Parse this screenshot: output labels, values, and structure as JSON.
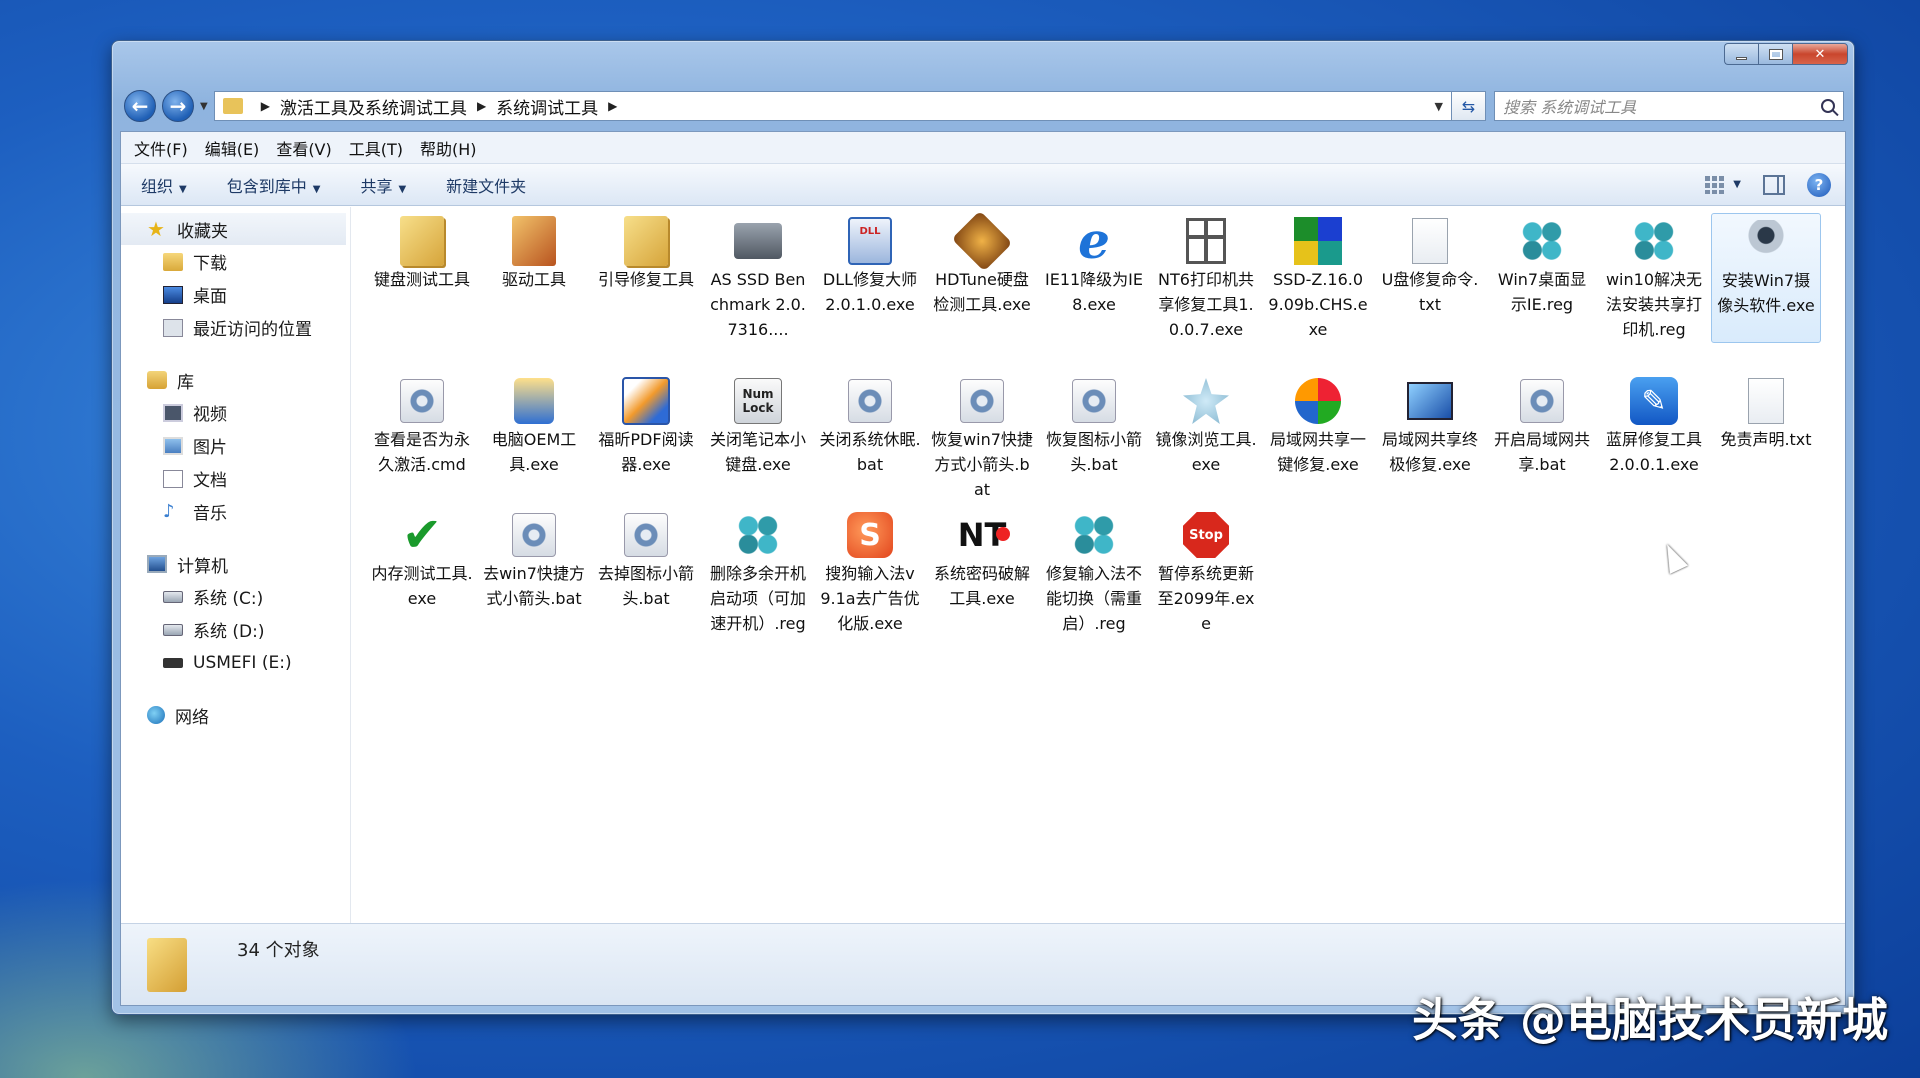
{
  "window": {
    "controls": {
      "minimize": "—",
      "maximize": "□",
      "close": "✕"
    }
  },
  "address": {
    "crumbs": [
      "激活工具及系统调试工具",
      "系统调试工具"
    ],
    "search_placeholder": "搜索 系统调试工具"
  },
  "menu": [
    "文件(F)",
    "编辑(E)",
    "查看(V)",
    "工具(T)",
    "帮助(H)"
  ],
  "toolbar": {
    "organize": "组织",
    "include_library": "包含到库中",
    "share": "共享",
    "new_folder": "新建文件夹"
  },
  "sidebar": {
    "favorites": {
      "label": "收藏夹",
      "items": [
        "下载",
        "桌面",
        "最近访问的位置"
      ]
    },
    "libraries": {
      "label": "库",
      "items": [
        "视频",
        "图片",
        "文档",
        "音乐"
      ]
    },
    "computer": {
      "label": "计算机",
      "items": [
        "系统 (C:)",
        "系统 (D:)",
        "USMEFI (E:)"
      ]
    },
    "network": {
      "label": "网络"
    }
  },
  "files": [
    {
      "name": "键盘测试工具",
      "icon": "folder-icon"
    },
    {
      "name": "驱动工具",
      "icon": "folder-icon"
    },
    {
      "name": "引导修复工具",
      "icon": "folder-icon"
    },
    {
      "name": "AS SSD Benchmark 2.0.7316....",
      "icon": "disk-icon"
    },
    {
      "name": "DLL修复大师2.0.1.0.exe",
      "icon": "dll-icon"
    },
    {
      "name": "HDTune硬盘检测工具.exe",
      "icon": "hdd-icon"
    },
    {
      "name": "IE11降级为IE8.exe",
      "icon": "ie-icon"
    },
    {
      "name": "NT6打印机共享修复工具1.0.0.7.exe",
      "icon": "gift-icon"
    },
    {
      "name": "SSD-Z.16.09.09b.CHS.exe",
      "icon": "ssdz-icon"
    },
    {
      "name": "U盘修复命令.txt",
      "icon": "text-file-icon"
    },
    {
      "name": "Win7桌面显示IE.reg",
      "icon": "registry-icon"
    },
    {
      "name": "win10解决无法安装共享打印机.reg",
      "icon": "registry-icon"
    },
    {
      "name": "安装Win7摄像头软件.exe",
      "icon": "webcam-icon"
    },
    {
      "name": "查看是否为永久激活.cmd",
      "icon": "gear-file-icon"
    },
    {
      "name": "电脑OEM工具.exe",
      "icon": "oem-icon"
    },
    {
      "name": "福昕PDF阅读器.exe",
      "icon": "pdf-icon"
    },
    {
      "name": "关闭笔记本小键盘.exe",
      "icon": "numlock-icon"
    },
    {
      "name": "关闭系统休眠.bat",
      "icon": "gear-file-icon"
    },
    {
      "name": "恢复win7快捷方式小箭头.bat",
      "icon": "gear-file-icon"
    },
    {
      "name": "恢复图标小箭头.bat",
      "icon": "gear-file-icon"
    },
    {
      "name": "镜像浏览工具.exe",
      "icon": "mirror-icon"
    },
    {
      "name": "局域网共享一键修复.exe",
      "icon": "pinwheel-icon"
    },
    {
      "name": "局域网共享终极修复.exe",
      "icon": "monitor-icon"
    },
    {
      "name": "开启局域网共享.bat",
      "icon": "gear-file-icon"
    },
    {
      "name": "蓝屏修复工具2.0.0.1.exe",
      "icon": "wrench-icon"
    },
    {
      "name": "免责声明.txt",
      "icon": "text-file-icon"
    },
    {
      "name": "内存测试工具.exe",
      "icon": "checkmark-icon"
    },
    {
      "name": "去win7快捷方式小箭头.bat",
      "icon": "gear-file-icon"
    },
    {
      "name": "去掉图标小箭头.bat",
      "icon": "gear-file-icon"
    },
    {
      "name": "删除多余开机启动项（可加速开机）.reg",
      "icon": "registry-icon"
    },
    {
      "name": "搜狗输入法v9.1a去广告优化版.exe",
      "icon": "sogou-icon"
    },
    {
      "name": "系统密码破解工具.exe",
      "icon": "nt-password-icon"
    },
    {
      "name": "修复输入法不能切换（需重启）.reg",
      "icon": "registry-icon"
    },
    {
      "name": "暂停系统更新至2099年.exe",
      "icon": "stop-icon"
    }
  ],
  "icon_text": {
    "numlock_1": "Num",
    "numlock_2": "Lock",
    "dll": "DLL",
    "stop": "Stop",
    "ie": "e",
    "wrench": "✎",
    "check": "✔",
    "sogou": "S",
    "nt": "NT"
  },
  "status": {
    "count": "34 个对象"
  },
  "watermark": "头条 @电脑技术员新城"
}
